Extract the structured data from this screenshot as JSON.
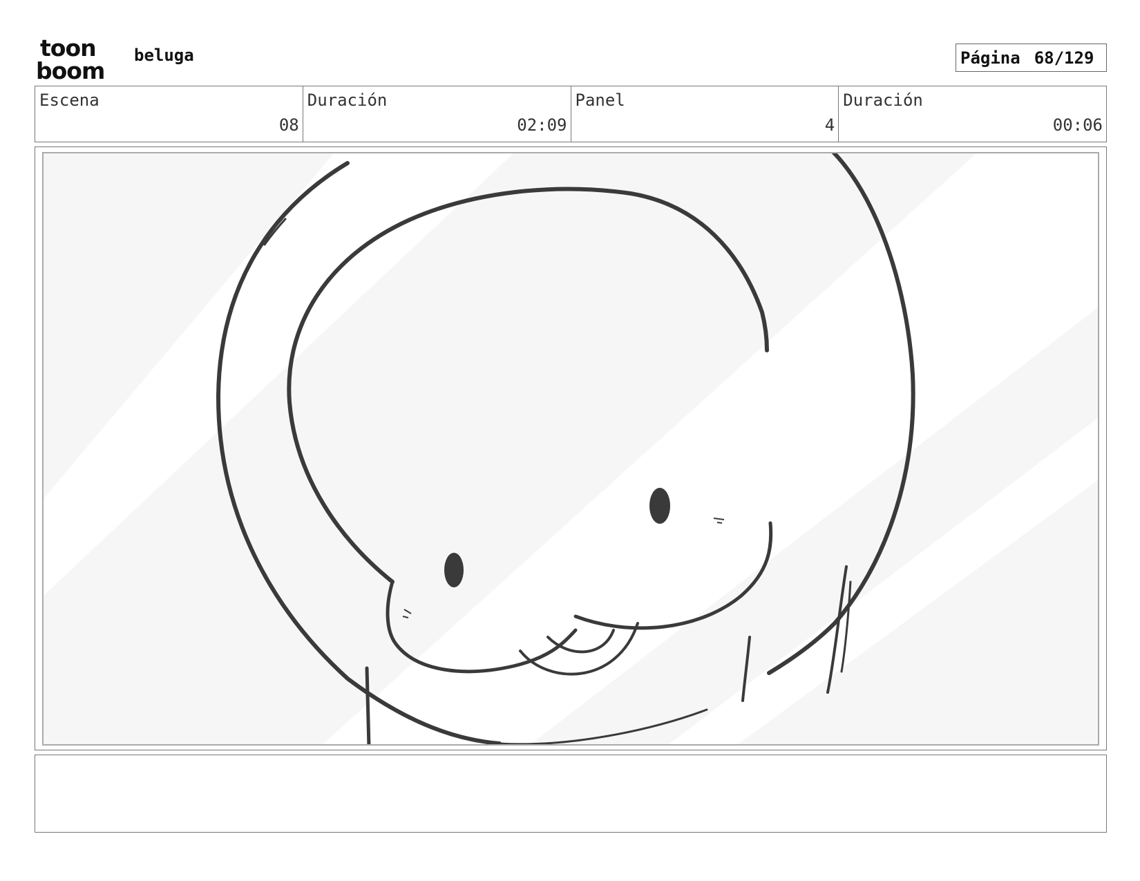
{
  "logo": {
    "line1": "toon",
    "line2": "boom"
  },
  "project": {
    "title": "beluga"
  },
  "page": {
    "label": "Página",
    "value": "68/129"
  },
  "info": [
    {
      "caption": "Escena",
      "value": "08"
    },
    {
      "caption": "Duración",
      "value": "02:09"
    },
    {
      "caption": "Panel",
      "value": "4"
    },
    {
      "caption": "Duración",
      "value": "00:06"
    }
  ],
  "notes": {
    "text": ""
  }
}
